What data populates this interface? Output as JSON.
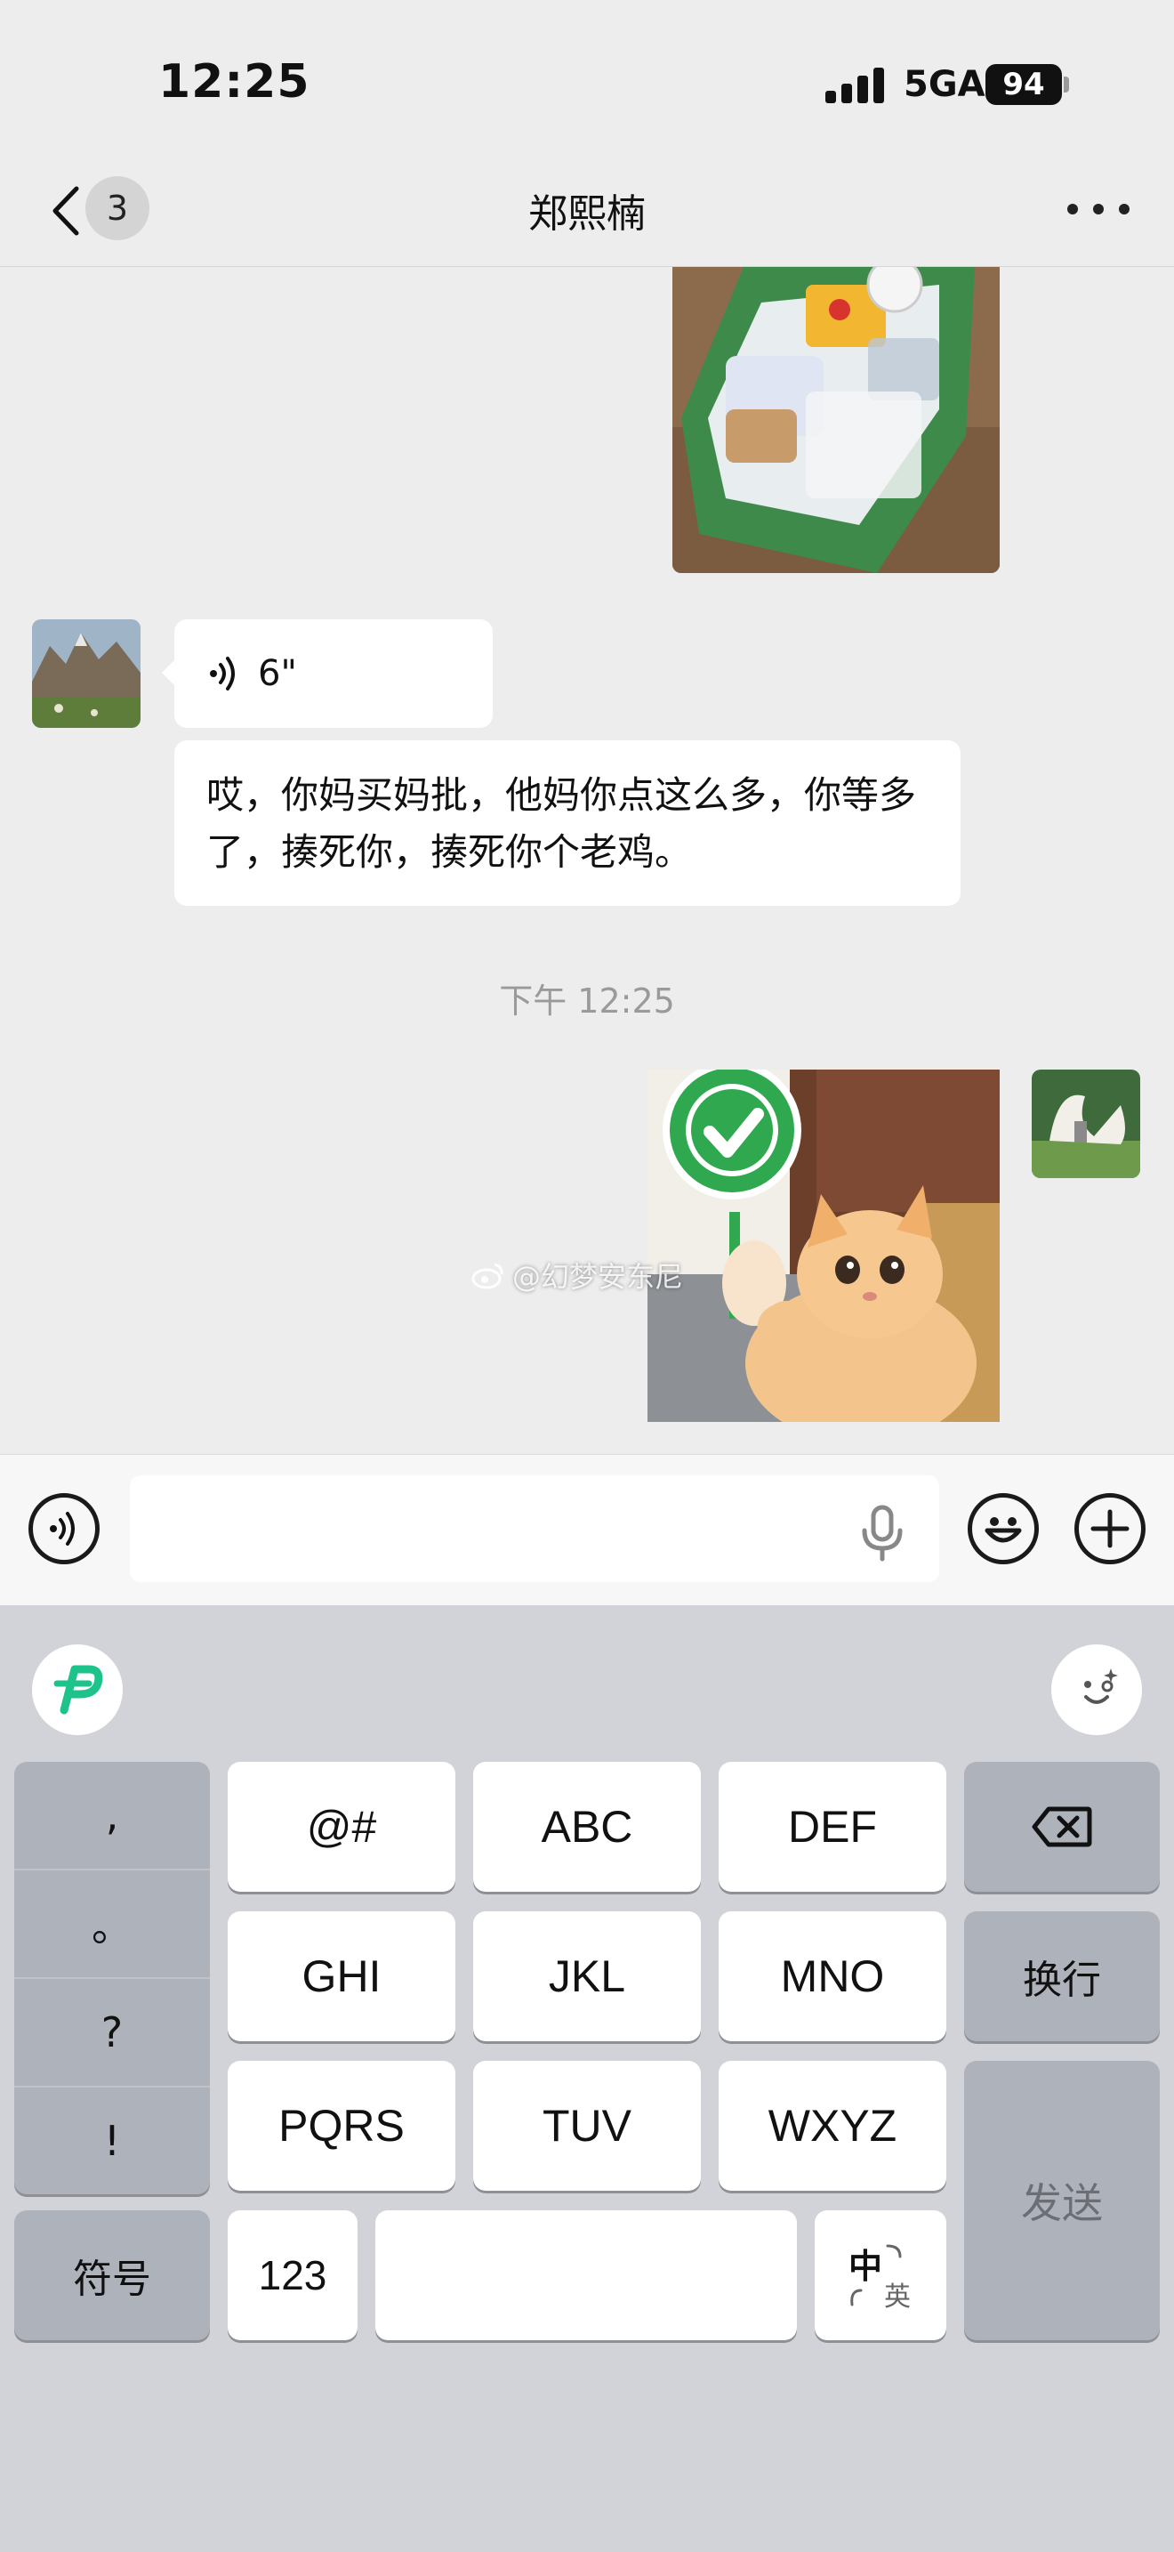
{
  "status_bar": {
    "time": "12:25",
    "network": "5GA",
    "battery": "94"
  },
  "nav": {
    "unread_count": "3",
    "title": "郑熙楠"
  },
  "messages": {
    "voice": {
      "duration": "6\""
    },
    "text": "哎，你妈买妈批，他妈你点这么多，你等多了，揍死你，揍死你个老鸡。",
    "timestamp": "下午 12:25",
    "watermark": "@幻梦安东尼"
  },
  "keyboard": {
    "punctuation": [
      ",",
      "。",
      "?",
      "!"
    ],
    "symbols_label": "符号",
    "keys_row1": [
      "@#",
      "ABC",
      "DEF"
    ],
    "keys_row2": [
      "GHI",
      "JKL",
      "MNO"
    ],
    "keys_row3": [
      "PQRS",
      "TUV",
      "WXYZ"
    ],
    "number_label": "123",
    "lang_primary": "中",
    "lang_secondary": "英",
    "newline_label": "换行",
    "send_label": "发送"
  },
  "colors": {
    "background": "#ededed",
    "bubble": "#ffffff",
    "keyboard": "#d1d3d9",
    "ime_accent": "#1ec28b",
    "check_green": "#2fa84f"
  }
}
